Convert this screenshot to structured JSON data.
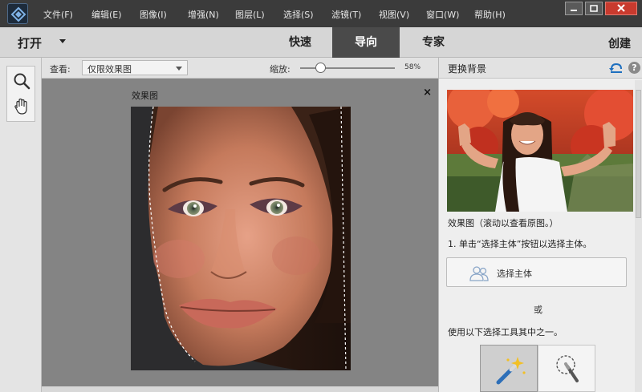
{
  "menubar": {
    "items": [
      "文件(F)",
      "编辑(E)",
      "图像(I)",
      "增强(N)",
      "图层(L)",
      "选择(S)",
      "滤镜(T)",
      "视图(V)",
      "窗口(W)",
      "帮助(H)"
    ],
    "minimize_icon": "minimize-icon",
    "restore_icon": "restore-icon",
    "close_icon": "close-icon"
  },
  "modebar": {
    "open_label": "打开",
    "tabs": [
      {
        "label": "快速",
        "active": false
      },
      {
        "label": "导向",
        "active": true
      },
      {
        "label": "专家",
        "active": false
      }
    ],
    "create_label": "创建"
  },
  "toolpanel": {
    "tools": [
      "zoom-icon",
      "hand-icon"
    ]
  },
  "options": {
    "view_label": "查看:",
    "view_value": "仅限效果图",
    "zoom_label": "缩放:",
    "zoom_value": "58%",
    "zoom_fraction": 0.22
  },
  "canvas": {
    "label": "效果图",
    "close_glyph": "×"
  },
  "panel": {
    "title": "更换背景",
    "preview_caption": "效果图（滚动以查看原图。）",
    "step1": "1. 单击“选择主体”按钮以选择主体。",
    "select_subject_label": "选择主体",
    "or_text": "或",
    "use_tools_text": "使用以下选择工具其中之一。",
    "help_glyph": "?"
  },
  "colors": {
    "menubar_bg": "#3b3b3b",
    "active_tab_bg": "#4a4a4a",
    "accent_blue": "#1e6fbf",
    "close_red": "#c83a2e"
  }
}
